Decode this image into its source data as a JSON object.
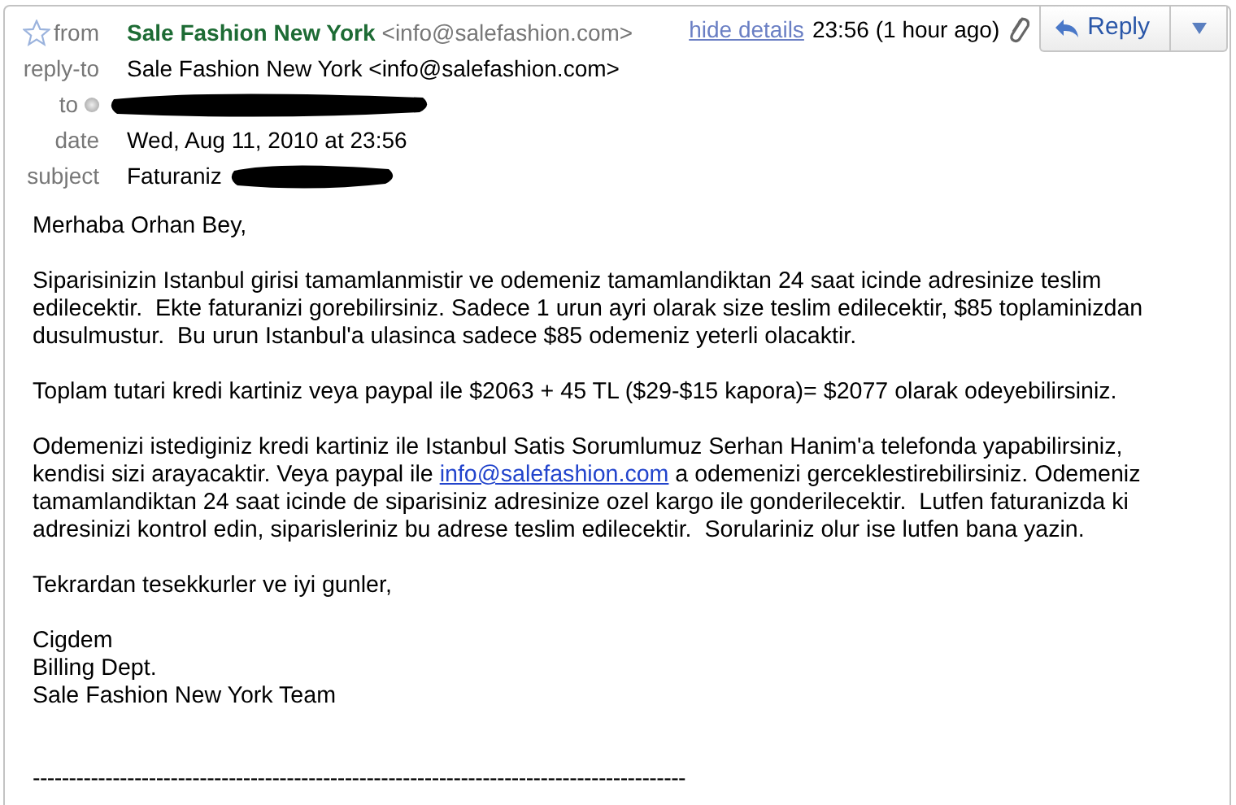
{
  "header": {
    "starred": false,
    "fields": [
      {
        "label": "from",
        "kind": "sender",
        "name": "Sale Fashion New York",
        "email": "<info@salefashion.com>"
      },
      {
        "label": "reply-to",
        "kind": "text",
        "value": "Sale Fashion New York <info@salefashion.com>"
      },
      {
        "label": "to",
        "kind": "redacted"
      },
      {
        "label": "date",
        "kind": "text",
        "value": "Wed, Aug 11, 2010 at 23:56"
      },
      {
        "label": "subject",
        "kind": "subject",
        "value": "Faturaniz"
      }
    ],
    "details_link": "hide details",
    "time": "23:56 (1 hour ago)",
    "has_attachment": true,
    "reply_button": "Reply"
  },
  "body": [
    {
      "lines": [
        [
          {
            "text": "Merhaba Orhan Bey,"
          }
        ]
      ]
    },
    {
      "lines": [
        [
          {
            "text": "Siparisinizin Istanbul girisi tamamlanmistir ve odemeniz tamamlandiktan 24 saat icinde adresinize teslim"
          }
        ],
        [
          {
            "text": "edilecektir.  Ekte faturanizi gorebilirsiniz. Sadece 1 urun ayri olarak size teslim edilecektir, $85 toplaminizdan"
          }
        ],
        [
          {
            "text": "dusulmustur.  Bu urun Istanbul'a ulasinca sadece $85 odemeniz yeterli olacaktir."
          }
        ]
      ]
    },
    {
      "lines": [
        [
          {
            "text": "Toplam tutari kredi kartiniz veya paypal ile $2063 + 45 TL ($29-$15 kapora)= $2077 olarak odeyebilirsiniz."
          }
        ]
      ]
    },
    {
      "lines": [
        [
          {
            "text": "Odemenizi istediginiz kredi kartiniz ile Istanbul Satis Sorumlumuz Serhan Hanim'a telefonda yapabilirsiniz,"
          }
        ],
        [
          {
            "text": "kendisi sizi arayacaktir. Veya paypal ile "
          },
          {
            "text": "info@salefashion.com",
            "link": true
          },
          {
            "text": " a odemenizi gerceklestirebilirsiniz. Odemeniz"
          }
        ],
        [
          {
            "text": "tamamlandiktan 24 saat icinde de siparisiniz adresinize ozel kargo ile gonderilecektir.  Lutfen faturanizda ki"
          }
        ],
        [
          {
            "text": "adresinizi kontrol edin, siparisleriniz bu adrese teslim edilecektir.  Sorulariniz olur ise lutfen bana yazin."
          }
        ]
      ]
    },
    {
      "lines": [
        [
          {
            "text": "Tekrardan tesekkurler ve iyi gunler,"
          }
        ]
      ]
    },
    {
      "lines": [
        [
          {
            "text": "Cigdem"
          }
        ],
        [
          {
            "text": "Billing Dept."
          }
        ],
        [
          {
            "text": "Sale Fashion New York Team"
          }
        ]
      ]
    }
  ],
  "separator": "------------------------------------------------------------------------------------------"
}
